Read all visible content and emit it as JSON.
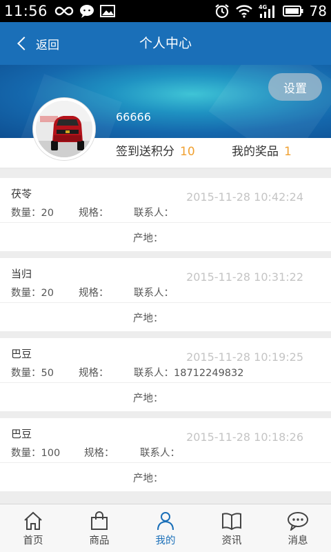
{
  "status_bar": {
    "time": "11:56",
    "battery": "78",
    "network": "4G"
  },
  "header": {
    "back_label": "返回",
    "title": "个人中心"
  },
  "profile": {
    "settings_label": "设置",
    "username": "66666",
    "points_label": "签到送积分",
    "points_value": "10",
    "prizes_label": "我的奖品",
    "prizes_value": "1"
  },
  "colors": {
    "primary": "#1a6fb8",
    "accent_number": "#f0a030",
    "timestamp": "#c4c4c4"
  },
  "listings": [
    {
      "name": "茯苓",
      "date": "2015-11-28 10:42:24",
      "quantity": "数量：20",
      "spec": "规格：",
      "contact": "联系人：",
      "origin": "产地："
    },
    {
      "name": "当归",
      "date": "2015-11-28 10:31:22",
      "quantity": "数量：20",
      "spec": "规格：",
      "contact": "联系人：",
      "origin": "产地："
    },
    {
      "name": "巴豆",
      "date": "2015-11-28 10:19:25",
      "quantity": "数量：50",
      "spec": "规格：",
      "contact": "联系人：18712249832",
      "origin": "产地："
    },
    {
      "name": "巴豆",
      "date": "2015-11-28 10:18:26",
      "quantity": "数量：100",
      "spec": "规格：",
      "contact": "联系人：",
      "origin": "产地："
    }
  ],
  "bottom_nav": [
    {
      "label": "首页",
      "icon": "home-icon",
      "active": false
    },
    {
      "label": "商品",
      "icon": "shopping-bag-icon",
      "active": false
    },
    {
      "label": "我的",
      "icon": "person-icon",
      "active": true
    },
    {
      "label": "资讯",
      "icon": "book-icon",
      "active": false
    },
    {
      "label": "消息",
      "icon": "chat-bubble-icon",
      "active": false
    }
  ]
}
